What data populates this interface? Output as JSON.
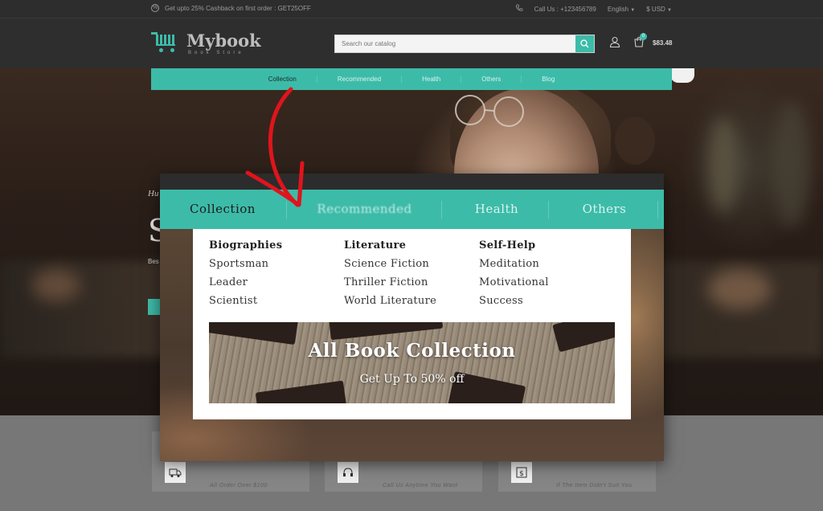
{
  "topbar": {
    "promo": "Get upto 25% Cashback on first order : GET25OFF",
    "call": "Call Us : +123456789",
    "language": "English",
    "currency": "$ USD"
  },
  "header": {
    "logo_name": "Mybook",
    "logo_sub": "Book Store",
    "search_placeholder": "Search our catalog",
    "cart_count": "0",
    "cart_total": "$83.48"
  },
  "nav": {
    "items": [
      "Collection",
      "Recommended",
      "Health",
      "Others",
      "Blog"
    ],
    "active": "Collection"
  },
  "hero": {
    "line1": "Hu",
    "line2": "S",
    "line3": "Bes"
  },
  "features": [
    {
      "icon": "truck-icon",
      "label": "All Order Over $100"
    },
    {
      "icon": "headset-icon",
      "label": "Call Us Anytime You Want"
    },
    {
      "icon": "money-icon",
      "label": "If The Item Didn't Suit You"
    }
  ],
  "zoom": {
    "nav": [
      "Collection",
      "Recommended",
      "Health",
      "Others"
    ],
    "columns": [
      {
        "heading": "Biographies",
        "items": [
          "Sportsman",
          "Leader",
          "Scientist"
        ]
      },
      {
        "heading": "Literature",
        "items": [
          "Science Fiction",
          "Thriller Fiction",
          "World Literature"
        ]
      },
      {
        "heading": "Self-Help",
        "items": [
          "Meditation",
          "Motivational",
          "Success"
        ]
      }
    ],
    "banner_title": "All Book Collection",
    "banner_sub": "Get Up To 50% off"
  },
  "colors": {
    "accent": "#3dbba9",
    "arrow": "#e0141c"
  }
}
